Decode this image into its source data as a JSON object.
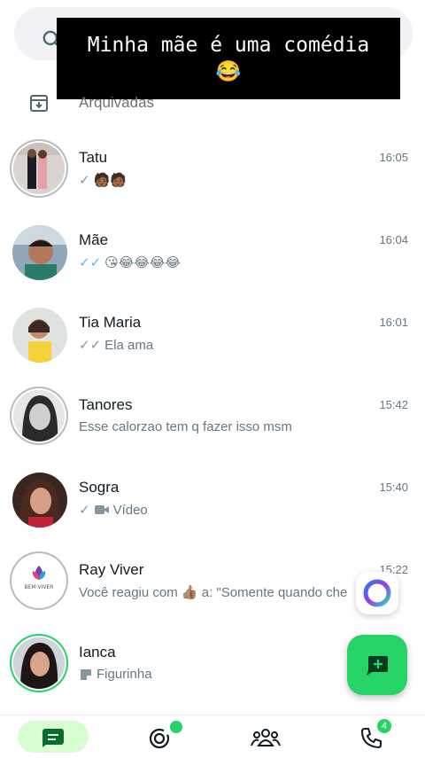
{
  "overlay": {
    "line1": "Minha mãe é uma comédia",
    "line2": "😂"
  },
  "archived": {
    "label": "Arquivadas"
  },
  "chats": [
    {
      "name": "Tatu",
      "time": "16:05",
      "tick": "✓",
      "tick_state": "sent",
      "preview": "🧑🏾🧑🏾"
    },
    {
      "name": "Mãe",
      "time": "16:04",
      "tick": "✓✓",
      "tick_state": "read",
      "preview": "😘😂😂😂😂"
    },
    {
      "name": "Tia Maria",
      "time": "16:01",
      "tick": "✓✓",
      "tick_state": "delivered",
      "preview": "Ela ama"
    },
    {
      "name": "Tanores",
      "time": "15:42",
      "tick": "",
      "tick_state": "none",
      "preview": "Esse calorzao tem q fazer isso msm"
    },
    {
      "name": "Sogra",
      "time": "15:40",
      "tick": "✓",
      "tick_state": "sent",
      "media_icon": "video-icon",
      "preview": "Vídeo"
    },
    {
      "name": "Ray Viver",
      "time": "15:22",
      "tick": "",
      "tick_state": "none",
      "preview": "Você reagiu com 👍🏽 a: \"Somente quando che"
    },
    {
      "name": "Ianca",
      "time": "",
      "tick": "",
      "tick_state": "none",
      "media_icon": "sticker-icon",
      "preview": "Figurinha"
    }
  ],
  "ray_viver_logo_text": "BEM VIVER",
  "nav": {
    "calls_badge": "4"
  },
  "colors": {
    "accent": "#25d366",
    "tick_read": "#53bdeb",
    "pill": "#d8fdd2"
  }
}
